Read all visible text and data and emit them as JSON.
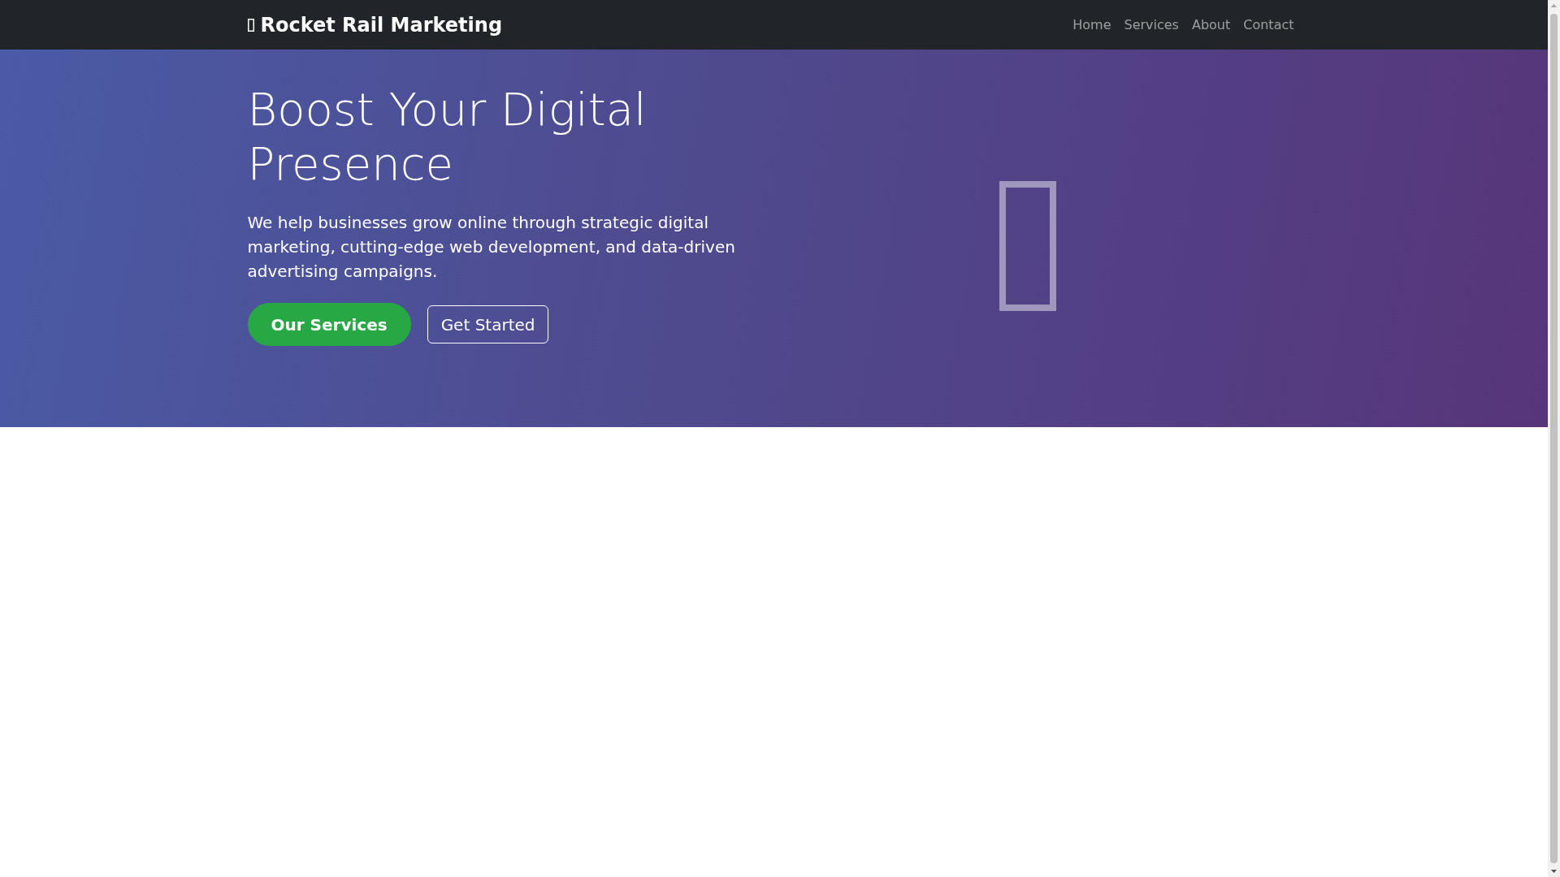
{
  "navbar": {
    "brand": "Rocket Rail Marketing",
    "links": [
      "Home",
      "Services",
      "About",
      "Contact"
    ]
  },
  "hero": {
    "title": "Boost Your Digital Presence",
    "lead": "We help businesses grow online through strategic digital marketing, cutting-edge web development, and data-driven advertising campaigns.",
    "buttons": [
      {
        "label": "Our Services",
        "kind": "primary"
      },
      {
        "label": "Get Started",
        "kind": "outline"
      }
    ]
  }
}
